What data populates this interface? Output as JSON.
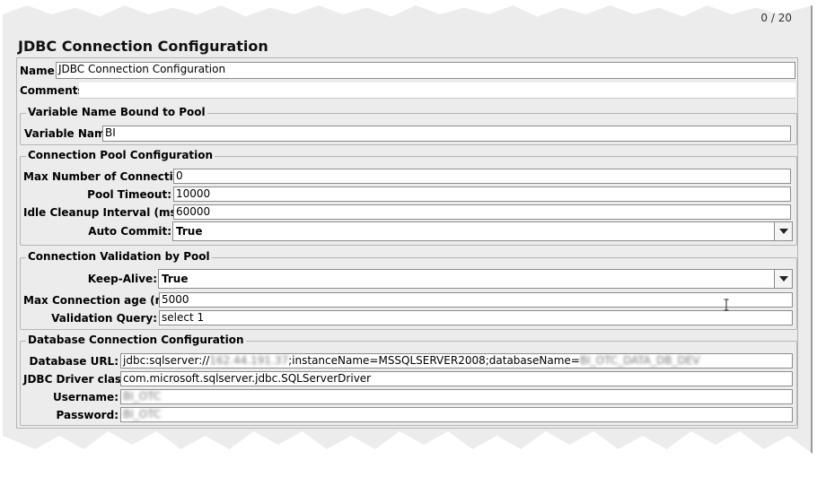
{
  "counter": "0 / 20",
  "title": "JDBC Connection Configuration",
  "name": {
    "label": "Name:",
    "value": "JDBC Connection Configuration"
  },
  "comments": {
    "label": "Comments:",
    "value": ""
  },
  "variable_group": {
    "title": "Variable Name Bound to Pool",
    "variable_name": {
      "label": "Variable Name:",
      "value": "BI"
    }
  },
  "pool_group": {
    "title": "Connection Pool Configuration",
    "max_connections": {
      "label": "Max Number of Connections:",
      "value": "0"
    },
    "pool_timeout": {
      "label": "Pool Timeout:",
      "value": "10000"
    },
    "idle_cleanup": {
      "label": "Idle Cleanup Interval (ms):",
      "value": "60000"
    },
    "auto_commit": {
      "label": "Auto Commit:",
      "value": "True"
    }
  },
  "validation_group": {
    "title": "Connection Validation by Pool",
    "keep_alive": {
      "label": "Keep-Alive:",
      "value": "True"
    },
    "max_age": {
      "label": "Max Connection age (ms):",
      "value": "5000"
    },
    "validation_query": {
      "label": "Validation Query:",
      "value": "select 1"
    }
  },
  "db_group": {
    "title": "Database Connection Configuration",
    "db_url": {
      "label": "Database URL:",
      "prefix": "jdbc:sqlserver://",
      "host_blurred": "162.44.191.37",
      "middle": ";instanceName=MSSQLSERVER2008;databaseName=",
      "db_blurred": "BI_OTC_DATA_DB_DEV"
    },
    "driver_class": {
      "label": "JDBC Driver class:",
      "value": "com.microsoft.sqlserver.jdbc.SQLServerDriver"
    },
    "username": {
      "label": "Username:",
      "value_blurred": "BI_OTC"
    },
    "password": {
      "label": "Password:",
      "value_blurred": "BI_OTC"
    }
  }
}
